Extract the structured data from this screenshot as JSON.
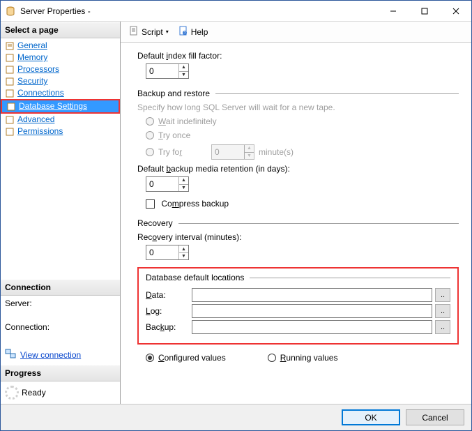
{
  "window": {
    "title": "Server Properties -"
  },
  "titlebar_buttons": {
    "min": "—",
    "max": "▢",
    "close": "✕"
  },
  "sidebar": {
    "select_page": "Select a page",
    "items": [
      {
        "label": "General"
      },
      {
        "label": "Memory"
      },
      {
        "label": "Processors"
      },
      {
        "label": "Security"
      },
      {
        "label": "Connections"
      },
      {
        "label": "Database Settings",
        "selected": true
      },
      {
        "label": "Advanced"
      },
      {
        "label": "Permissions"
      }
    ],
    "connection_header": "Connection",
    "server_label": "Server:",
    "server_value": "",
    "connection_label": "Connection:",
    "connection_value": "",
    "view_connection": "View connection ",
    "progress_header": "Progress",
    "progress_status": "Ready"
  },
  "toolbar": {
    "script": "Script",
    "help": "Help"
  },
  "content": {
    "fill_factor_label": "Default index fill factor:",
    "fill_factor_value": "0",
    "backup_restore_header": "Backup and restore",
    "backup_hint": "Specify how long SQL Server will wait for a new tape.",
    "wait_indef": "Wait indefinitely",
    "try_once": "Try once",
    "try_for": "Try for",
    "try_for_value": "0",
    "try_for_unit": "minute(s)",
    "retention_label": "Default backup media retention (in days):",
    "retention_value": "0",
    "compress_label": "Compress backup",
    "recovery_header": "Recovery",
    "recovery_interval_label": "Recovery interval (minutes):",
    "recovery_interval_value": "0",
    "locations_header": "Database default locations",
    "data_label": "Data:",
    "data_value": "",
    "log_label": "Log:",
    "log_value": "",
    "backup_label": "Backup:",
    "backup_value": "",
    "browse_label": "..",
    "configured": "Configured values",
    "running": "Running values"
  },
  "footer": {
    "ok": "OK",
    "cancel": "Cancel"
  }
}
